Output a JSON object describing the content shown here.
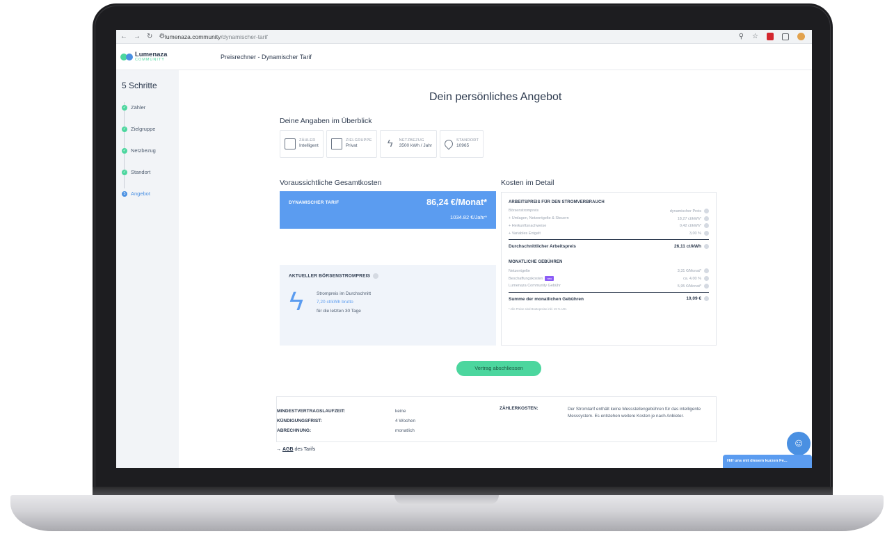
{
  "browser": {
    "url_host": "lumenaza.community",
    "url_path": "/dynamischer-tarif"
  },
  "header": {
    "logo_name": "Lumenaza",
    "logo_sub": "COMMUNITY",
    "title": "Preisrechner - Dynamischer Tarif"
  },
  "sidebar": {
    "title": "5 Schritte",
    "steps": [
      {
        "label": "Zähler",
        "state": "done"
      },
      {
        "label": "Zielgruppe",
        "state": "done"
      },
      {
        "label": "Netzbezug",
        "state": "done"
      },
      {
        "label": "Standort",
        "state": "done"
      },
      {
        "label": "Angebot",
        "state": "active",
        "number": "5"
      }
    ]
  },
  "main": {
    "title": "Dein persönliches Angebot",
    "overview_label": "Deine Angaben im Überblick",
    "chips": [
      {
        "label": "ZÄHLER",
        "value": "Intelligent",
        "icon": "meter-icon"
      },
      {
        "label": "ZIELGRUPPE",
        "value": "Privat",
        "icon": "house-icon"
      },
      {
        "label": "NETZBEZUG",
        "value": "3500 kWh / Jahr",
        "icon": "bolt-icon"
      },
      {
        "label": "STANDORT",
        "value": "10965",
        "icon": "location-pin-icon"
      }
    ],
    "total_label": "Voraussichtliche Gesamtkosten",
    "detail_label": "Kosten im Detail"
  },
  "price": {
    "name": "DYNAMISCHER TARIF",
    "monthly": "86,24 €/Monat*",
    "yearly": "1034.82 €/Jahr*"
  },
  "boerse": {
    "title": "AKTUELLER BÖRSENSTROMPREIS",
    "line1": "Strompreis im Durchschnitt",
    "line2": "7,20 ct/kWh brutto",
    "line3": "für die letzten 30 Tage"
  },
  "details": {
    "arbeitspreis_header": "ARBEITSPREIS FÜR DEN STROMVERBRAUCH",
    "rows1": [
      {
        "label": "Börsenstrompreis",
        "value": "dynamischer Preis"
      },
      {
        "label": "+ Umlagen, Netzentgelte & Steuern",
        "value": "18,27 ct/kWh*"
      },
      {
        "label": "+ Herkunftsnachweise",
        "value": "0,42 ct/kWh*"
      },
      {
        "label": "+ Variables Entgelt",
        "value": "3,00 %"
      }
    ],
    "sum1_label": "Durchschnittlicher Arbeitspreis",
    "sum1_value": "26,11 ct/kWh",
    "gebuehren_header": "MONATLICHE GEBÜHREN",
    "rows2": [
      {
        "label": "Netzentgelte",
        "value": "3,31 €/Monat*"
      },
      {
        "label": "Beschaffungskosten",
        "value": "ca. 4,00 %",
        "tag": "neu"
      },
      {
        "label": "Lumenaza Community Gebühr",
        "value": "5,95 €/Monat*"
      }
    ],
    "sum2_label": "Summe der monatlichen Gebühren",
    "sum2_value": "10,09 €",
    "footnote": "* Alle Preise sind Bruttopreise inkl. 19 % USt."
  },
  "cta_label": "Vertrag abschliessen",
  "terms": {
    "rows": [
      {
        "key": "MINDESTVERTRAGSLAUFZEIT:",
        "value": "keine"
      },
      {
        "key": "KÜNDIGUNGSFRIST:",
        "value": "4 Wochen"
      },
      {
        "key": "ABRECHNUNG:",
        "value": "monatlich"
      }
    ],
    "meter_key": "ZÄHLERKOSTEN:",
    "meter_text": "Der Stromtarif enthält keine Messstellengebühren für das intelligente Messsystem. Es entstehen weitere Kosten je nach Anbieter."
  },
  "agb": {
    "prefix": "→ ",
    "link": "AGB",
    "suffix": " des Tarifs"
  },
  "feedback_label": "Hilf uns mit diesem kurzen Fe...",
  "colors": {
    "accent_blue": "#5b9cf0",
    "accent_green": "#4cd69e",
    "text_dark": "#2d3a4e"
  }
}
